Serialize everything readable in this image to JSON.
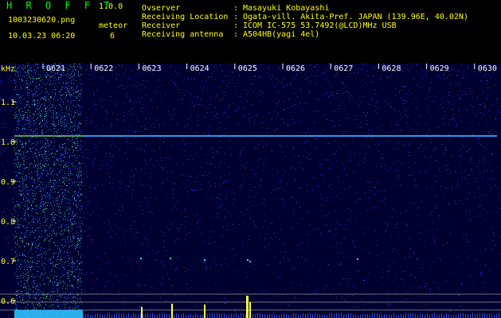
{
  "header": {
    "app_title": "H R O F F T",
    "version": "1.0.0",
    "filename": "1003230620.png",
    "datetime": "10.03.23 06:20",
    "meteor_label": "meteor",
    "meteor_count": "6"
  },
  "info": [
    {
      "label": "Ovserver",
      "value": "Masayuki Kobayashi"
    },
    {
      "label": "Receiving Location",
      "value": "Ogata-vill. Akita-Pref. JAPAN (139.96E, 40.02N)"
    },
    {
      "label": "Receiver",
      "value": "ICOM IC-575 53.7492(@LCD)MHz USB"
    },
    {
      "label": "Receiving antenna",
      "value": "A504HB(yagi 4el)"
    }
  ],
  "spectrogram": {
    "y_unit": "kHz",
    "y_ticks": [
      "1.1",
      "1.0",
      "0.9",
      "0.8",
      "0.7",
      "0.6"
    ],
    "x_ticks": [
      "0621",
      "0622",
      "0623",
      "0624",
      "0625",
      "0626",
      "0627",
      "0628",
      "0629",
      "0630"
    ],
    "colors": {
      "background": "#000030",
      "noise": "#3050ff",
      "axis_text": "#ffff00",
      "carrier": "#40b0ff",
      "meteor": "#00ffff",
      "reference_line": "#a0a0a0"
    }
  }
}
